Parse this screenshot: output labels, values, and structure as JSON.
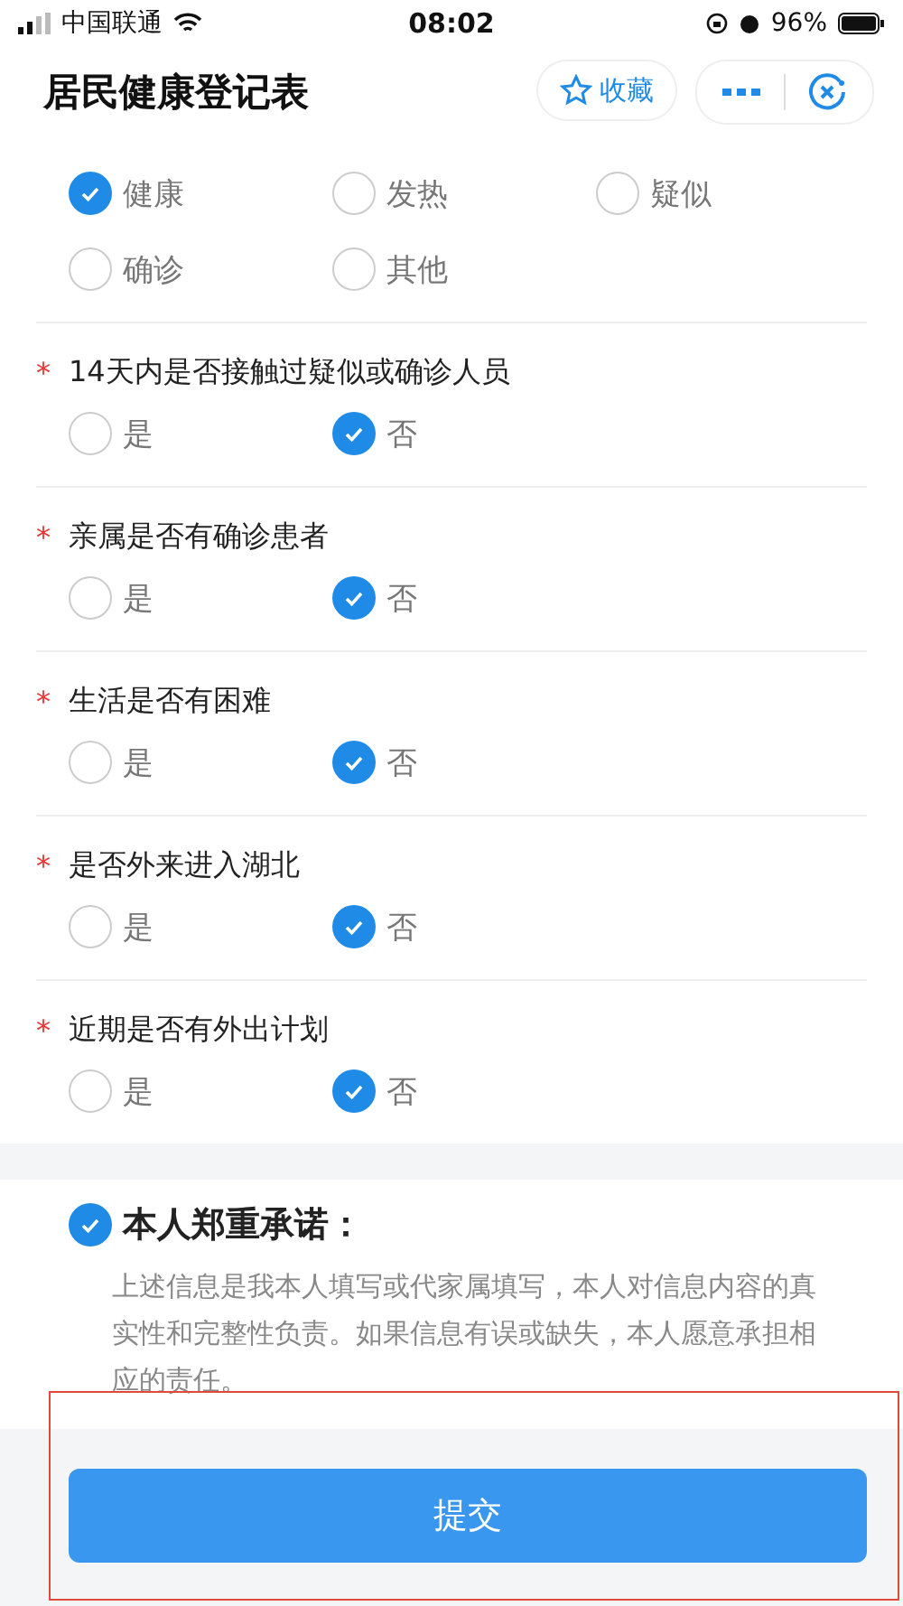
{
  "status_bar": {
    "carrier": "中国联通",
    "time": "08:02",
    "battery": "96%"
  },
  "header": {
    "title": "居民健康登记表",
    "favorite": "收藏"
  },
  "first_group": {
    "options": [
      {
        "label": "健康",
        "selected": true
      },
      {
        "label": "发热",
        "selected": false
      },
      {
        "label": "疑似",
        "selected": false
      },
      {
        "label": "确诊",
        "selected": false
      },
      {
        "label": "其他",
        "selected": false
      }
    ]
  },
  "questions": [
    {
      "required": true,
      "title": "14天内是否接触过疑似或确诊人员",
      "options": [
        {
          "label": "是",
          "selected": false
        },
        {
          "label": "否",
          "selected": true
        }
      ]
    },
    {
      "required": true,
      "title": "亲属是否有确诊患者",
      "options": [
        {
          "label": "是",
          "selected": false
        },
        {
          "label": "否",
          "selected": true
        }
      ]
    },
    {
      "required": true,
      "title": "生活是否有困难",
      "options": [
        {
          "label": "是",
          "selected": false
        },
        {
          "label": "否",
          "selected": true
        }
      ]
    },
    {
      "required": true,
      "title": "是否外来进入湖北",
      "options": [
        {
          "label": "是",
          "selected": false
        },
        {
          "label": "否",
          "selected": true
        }
      ]
    },
    {
      "required": true,
      "title": "近期是否有外出计划",
      "options": [
        {
          "label": "是",
          "selected": false
        },
        {
          "label": "否",
          "selected": true
        }
      ]
    }
  ],
  "required_mark": "*",
  "pledge": {
    "checked": true,
    "title": "本人郑重承诺：",
    "text": "上述信息是我本人填写或代家属填写，本人对信息内容的真实性和完整性负责。如果信息有误或缺失，本人愿意承担相应的责任。"
  },
  "submit": "提交"
}
